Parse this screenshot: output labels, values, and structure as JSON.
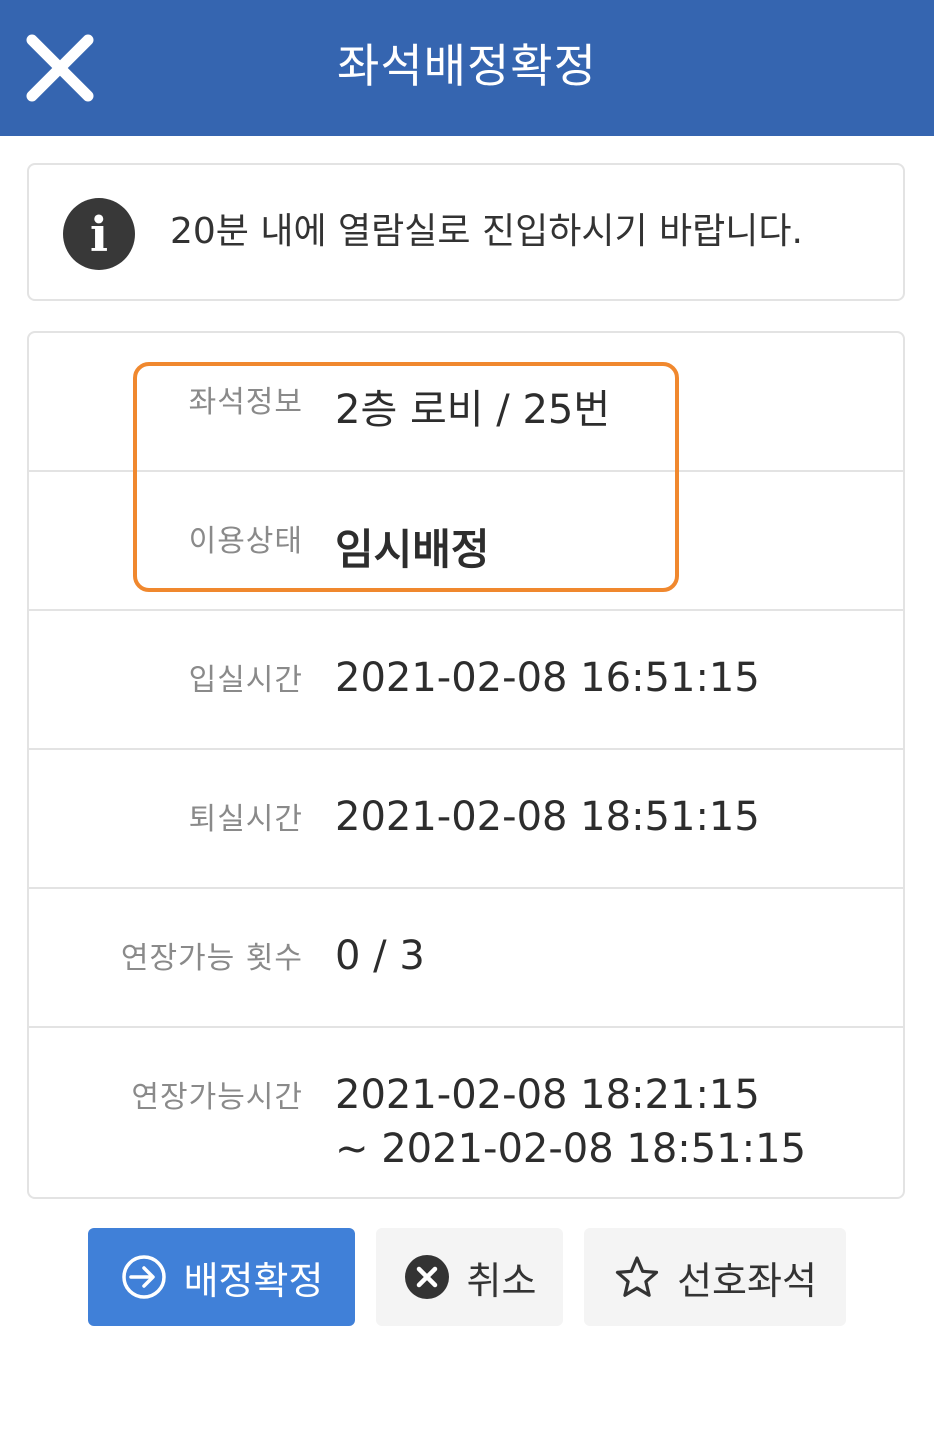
{
  "header": {
    "title": "좌석배정확정",
    "close_icon": "close-icon"
  },
  "notice": {
    "icon": "info-icon",
    "icon_glyph": "i",
    "text": "20분 내에 열람실로 진입하시기 바랍니다."
  },
  "details": {
    "seat_info": {
      "label": "좌석정보",
      "value": "2층 로비 / 25번"
    },
    "status": {
      "label": "이용상태",
      "value": "임시배정"
    },
    "checkin": {
      "label": "입실시간",
      "value": "2021-02-08 16:51:15"
    },
    "checkout": {
      "label": "퇴실시간",
      "value": "2021-02-08 18:51:15"
    },
    "extend_count": {
      "label": "연장가능 횟수",
      "value": "0 / 3"
    },
    "extend_time": {
      "label": "연장가능시간",
      "value_line1": "2021-02-08 18:21:15",
      "value_line2": "~ 2021-02-08 18:51:15"
    }
  },
  "actions": {
    "confirm": {
      "label": "배정확정",
      "icon": "enter-arrow-icon"
    },
    "cancel": {
      "label": "취소",
      "icon": "close-circle-icon"
    },
    "favorite": {
      "label": "선호좌석",
      "icon": "star-icon"
    }
  },
  "colors": {
    "header_bg": "#3565b0",
    "confirm_bg": "#4080d8",
    "highlight_border": "#f0882e"
  }
}
